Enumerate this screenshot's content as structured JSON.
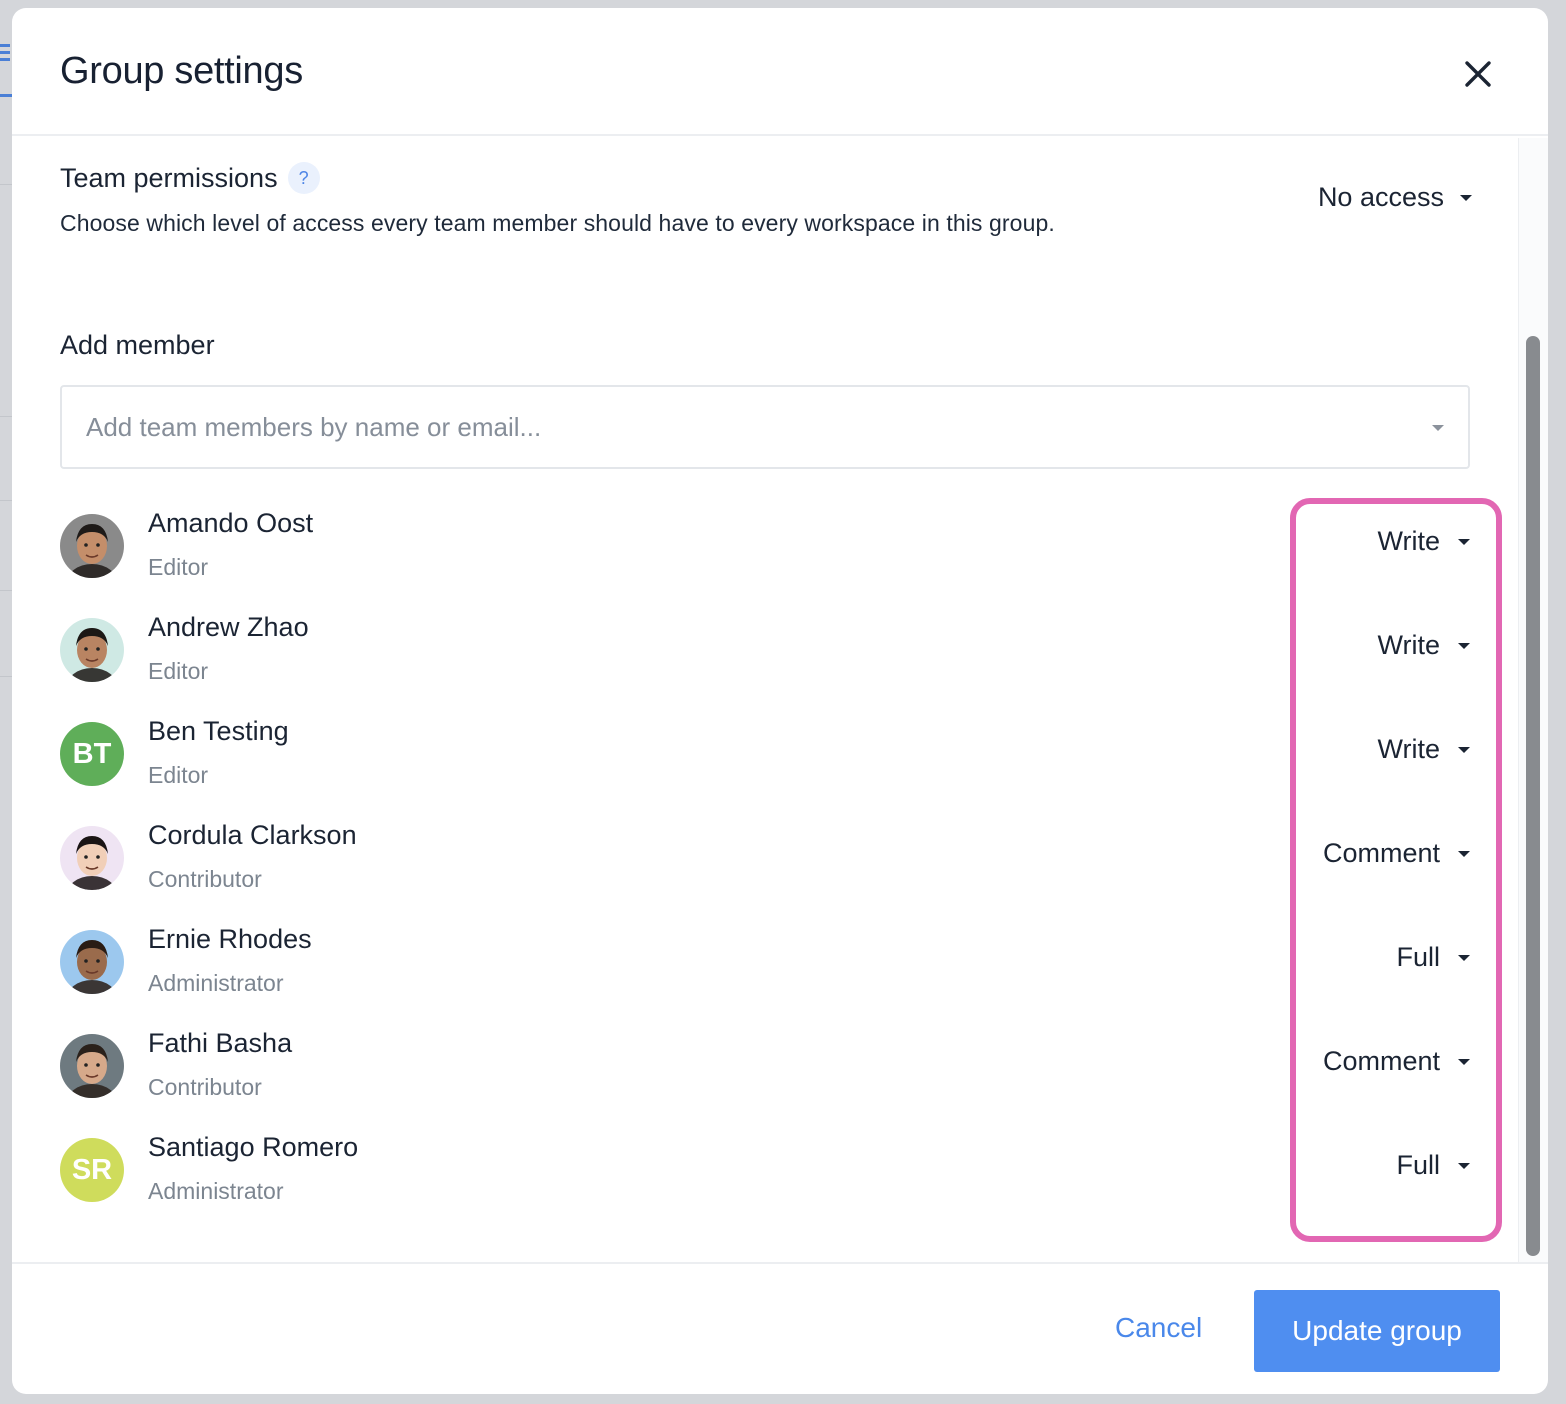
{
  "modal": {
    "title": "Group settings"
  },
  "team_permissions": {
    "title": "Team permissions",
    "help": "?",
    "description": "Choose which level of access every team member should have to every workspace in this group.",
    "value": "No access"
  },
  "add_member": {
    "label": "Add member",
    "placeholder": "Add team members by name or email..."
  },
  "members": [
    {
      "name": "Amando Oost",
      "role": "Editor",
      "permission": "Write",
      "avatar_type": "photo",
      "initials": ""
    },
    {
      "name": "Andrew Zhao",
      "role": "Editor",
      "permission": "Write",
      "avatar_type": "photo",
      "initials": ""
    },
    {
      "name": "Ben Testing",
      "role": "Editor",
      "permission": "Write",
      "avatar_type": "initials",
      "initials": "BT",
      "avatar_color": "#5fae59"
    },
    {
      "name": "Cordula Clarkson",
      "role": "Contributor",
      "permission": "Comment",
      "avatar_type": "photo",
      "initials": ""
    },
    {
      "name": "Ernie Rhodes",
      "role": "Administrator",
      "permission": "Full",
      "avatar_type": "photo",
      "initials": ""
    },
    {
      "name": "Fathi Basha",
      "role": "Contributor",
      "permission": "Comment",
      "avatar_type": "photo",
      "initials": ""
    },
    {
      "name": "Santiago Romero",
      "role": "Administrator",
      "permission": "Full",
      "avatar_type": "initials",
      "initials": "SR",
      "avatar_color": "#cfdc5c"
    }
  ],
  "footer": {
    "cancel_label": "Cancel",
    "update_label": "Update group"
  },
  "colors": {
    "accent": "#4f8ef0",
    "highlight": "#e267b3"
  }
}
